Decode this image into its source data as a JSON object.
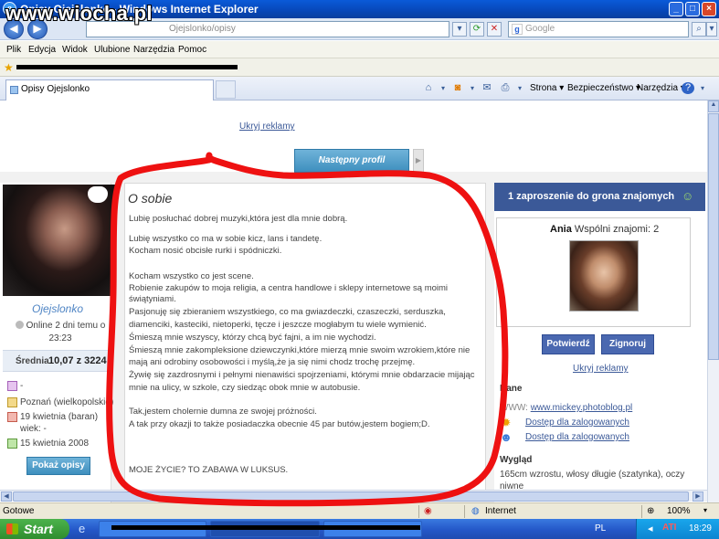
{
  "window": {
    "title": "Opisy Ojejslonko - Windows Internet Explorer",
    "watermark": "www.wiocha.pl"
  },
  "address": {
    "url": "Ojejslonko/opisy",
    "search_placeholder": "Google",
    "search_engine_letter": "g"
  },
  "menu": {
    "items": [
      "Plik",
      "Edycja",
      "Widok",
      "Ulubione",
      "Narzędzia",
      "Pomoc"
    ]
  },
  "tabs": {
    "active": "Opisy Ojejslonko",
    "tools": [
      "Strona",
      "Bezpieczeństwo",
      "Narzędzia"
    ]
  },
  "page": {
    "hide_ads": "Ukryj reklamy",
    "next_profile": "Następny profil",
    "profile": {
      "name": "Ojejslonko",
      "online_status": "Online 2 dni temu o 23:23",
      "average_label": "Średnia",
      "average_value": "10,07 z 3224",
      "info": [
        {
          "icon": "gender-icon",
          "text": "-"
        },
        {
          "icon": "location-icon",
          "text": "Poznań (wielkopolskie)"
        },
        {
          "icon": "birthday-icon",
          "text": "19 kwietnia (baran)"
        },
        {
          "icon": "age-icon",
          "text": "wiek: -"
        },
        {
          "icon": "joined-icon",
          "text": "15 kwietnia 2008"
        }
      ],
      "show_descriptions": "Pokaż opisy"
    },
    "about": {
      "title": "O sobie",
      "paragraphs": [
        "Lubię posłuchać dobrej muzyki,która jest dla mnie dobrą.",
        "Lubię wszystko co ma w sobie kicz, lans i tandetę.",
        "Kocham nosić obcisłe rurki i spódniczki.",
        "Kocham wszystko co jest scene.",
        "Robienie zakupów to moja religia, a centra handlowe i sklepy internetowe są moimi",
        "świątyniami.",
        "Pasjonuję się zbieraniem wszystkiego, co ma gwiazdeczki, czaszeczki, serduszka,",
        "diamenciki, kasteciki, nietoperki, tęcze i jeszcze mogłabym tu wiele wymienić.",
        "Śmieszą mnie wszyscy, którzy chcą być fajni, a im nie wychodzi.",
        "Śmieszą mnie zakompleksione dziewczynki,które mierzą mnie swoim wzrokiem,które nie",
        "mają ani odrobiny osobowości i myślą,że ja się nimi chodz trochę przejmę.",
        "Żywię się zazdrosnymi i pełnymi nienawiści spojrzeniami, którymi mnie obdarzacie mijając",
        "mnie na ulicy, w szkole, czy siedząc obok mnie w autobusie.",
        "Tak,jestem cholernie dumna ze swojej próżności.",
        "A tak przy okazji to także posiadaczka obecnie 45 par butów,jestem bogiem;D.",
        "MOJE ŻYCIE? TO ZABAWA W LUKSUS."
      ]
    },
    "invites": {
      "header": "1 zaproszenie do grona znajomych",
      "friend_name": "Ania",
      "mutual": "Wspólni znajomi: 2",
      "confirm": "Potwierdź",
      "ignore": "Zignoruj",
      "hide_ads": "Ukryj reklamy"
    },
    "details": {
      "data_label": "Dane",
      "www_label": "WWW:",
      "www_value": "www.mickey.photoblog.pl",
      "restricted_1": "Dostęp dla zalogowanych",
      "restricted_2": "Dostęp dla zalogowanych",
      "look_label": "Wygląd",
      "look_value": "165cm wzrostu, włosy długie (szatynka), oczy",
      "look_value_2": "niwne"
    }
  },
  "status": {
    "text": "Gotowe",
    "zone": "Internet",
    "zoom": "100%"
  },
  "taskbar": {
    "start": "Start",
    "lang": "PL",
    "clock": "18:29"
  },
  "colors": {
    "fb_blue": "#3b5998",
    "button_blue": "#3e8fbe",
    "marker_red": "#ee1111"
  }
}
